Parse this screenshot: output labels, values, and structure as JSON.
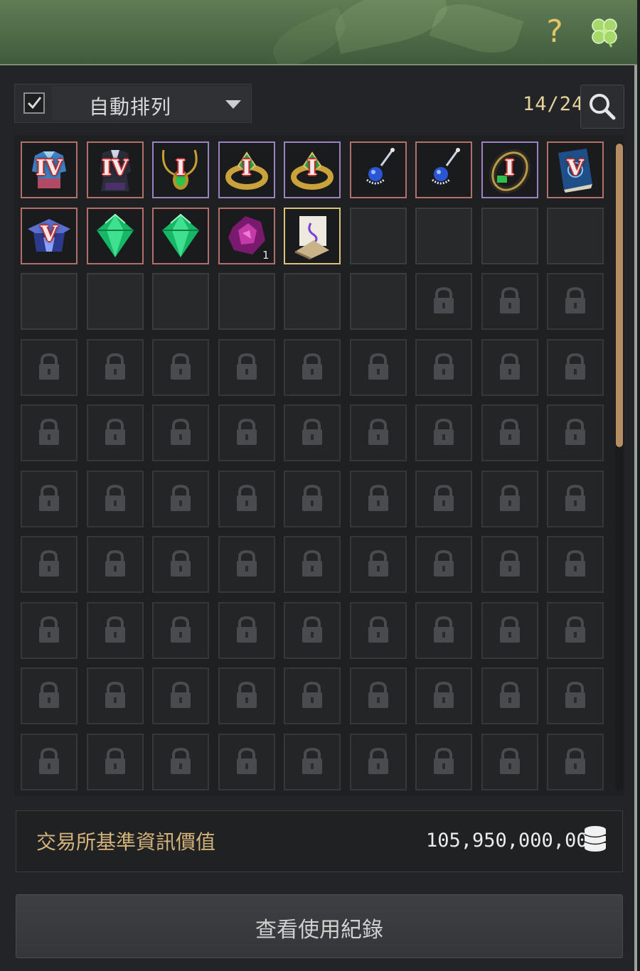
{
  "header": {
    "help_label": "?",
    "help_icon": "question-mark-icon",
    "clover_icon": "clover-icon"
  },
  "toolbar": {
    "auto_sort_checked": true,
    "sort_label": "自動排列",
    "slot_counter": "14/24",
    "search_icon": "search-icon"
  },
  "inventory": {
    "columns": 9,
    "rows": 10,
    "unlocked_slots": 24,
    "used_slots": 14,
    "items": [
      {
        "kind": "armor-top",
        "grade": "IV",
        "border": "red"
      },
      {
        "kind": "armor-robe",
        "grade": "IV",
        "border": "red"
      },
      {
        "kind": "necklace",
        "grade": "I",
        "border": "purple"
      },
      {
        "kind": "ring",
        "grade": "I",
        "border": "purple"
      },
      {
        "kind": "ring",
        "grade": "I",
        "border": "purple"
      },
      {
        "kind": "earring",
        "grade": "",
        "border": "red"
      },
      {
        "kind": "earring",
        "grade": "",
        "border": "red"
      },
      {
        "kind": "bracelet",
        "grade": "I",
        "border": "purple"
      },
      {
        "kind": "book",
        "grade": "V",
        "border": "red"
      },
      {
        "kind": "helmet",
        "grade": "V",
        "border": "red"
      },
      {
        "kind": "green-gem",
        "grade": "",
        "border": "red"
      },
      {
        "kind": "green-gem",
        "grade": "",
        "border": "red"
      },
      {
        "kind": "dark-stone",
        "grade": "",
        "border": "red",
        "quantity": "1"
      },
      {
        "kind": "scroll",
        "grade": "",
        "border": "gold"
      }
    ],
    "scroll_fraction": 0.47
  },
  "value_panel": {
    "label": "交易所基準資訊價值",
    "amount": "105,950,000,000",
    "coin_icon": "coin-stack-icon"
  },
  "log_button": {
    "label": "查看使用紀錄"
  },
  "colors": {
    "header_green": "#55714c",
    "border_red": "#b2706a",
    "border_purple": "#9b82c2",
    "border_gold": "#d9c27a",
    "label_gold": "#d3b27a",
    "scroll_thumb": "#b78e62"
  }
}
